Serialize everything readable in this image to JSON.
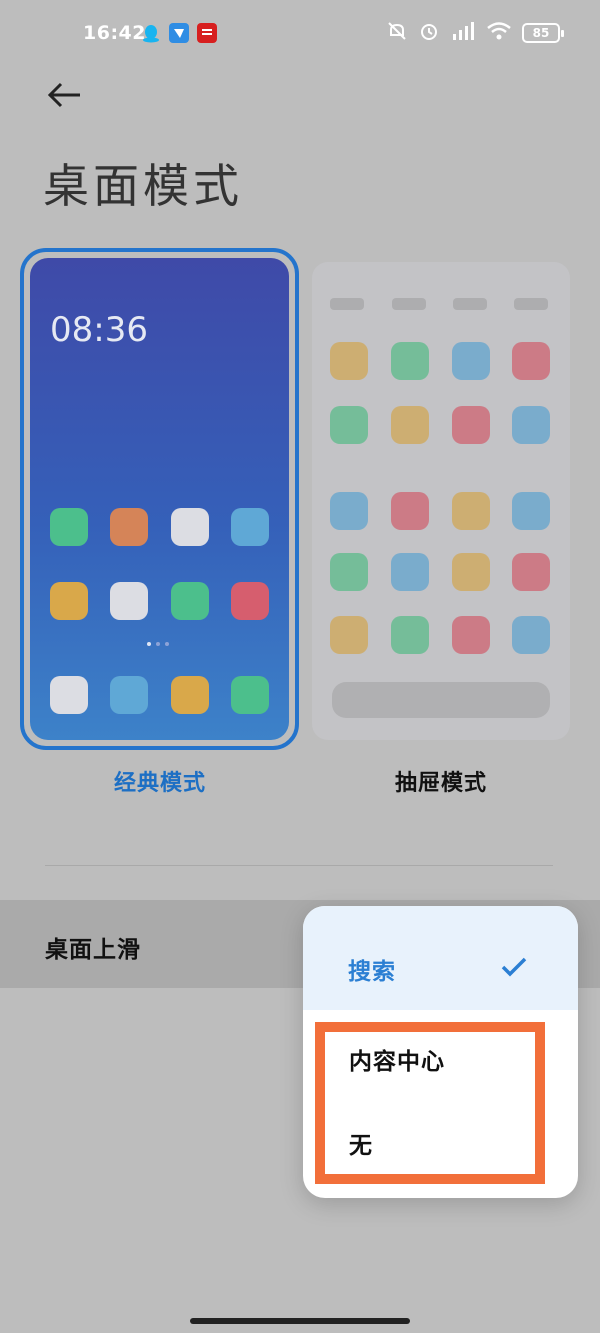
{
  "status_bar": {
    "time": "16:42",
    "battery": "85",
    "app_icons": [
      "qq-icon",
      "feishu-icon",
      "news-icon"
    ],
    "system_icons": [
      "mute-icon",
      "alarm-icon",
      "signal-icon",
      "wifi-icon",
      "battery-icon"
    ]
  },
  "page": {
    "title": "桌面模式"
  },
  "modes": {
    "classic": {
      "label": "经典模式",
      "selected": true,
      "preview_clock": "08:36"
    },
    "drawer": {
      "label": "抽屉模式",
      "selected": false
    }
  },
  "setting_row": {
    "label": "桌面上滑"
  },
  "popup_menu": {
    "options": [
      {
        "label": "搜索",
        "selected": true
      },
      {
        "label": "内容中心",
        "selected": false
      },
      {
        "label": "无",
        "selected": false
      }
    ]
  },
  "colors": {
    "accent": "#2b7fd3",
    "highlight": "#f26f3a",
    "selected_bg": "#e8f2fc",
    "overlay_bg": "#bdbdbd"
  }
}
